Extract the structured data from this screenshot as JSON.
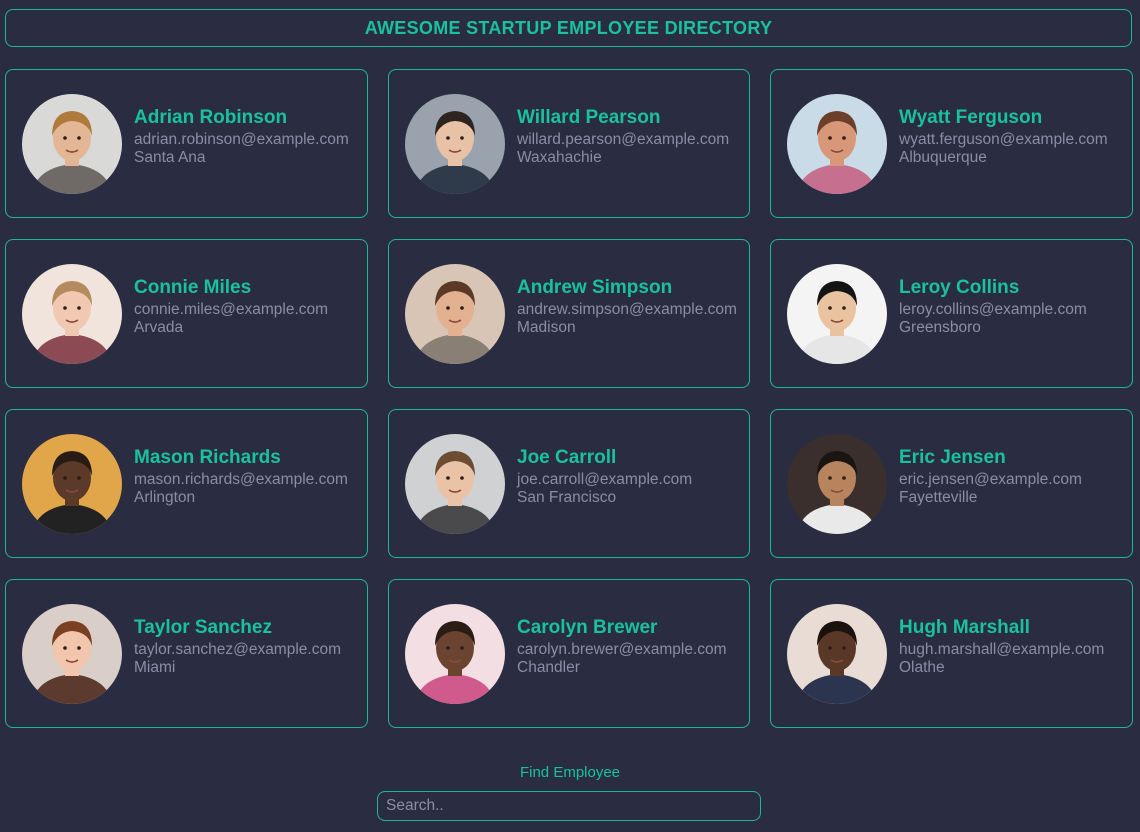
{
  "header": {
    "title": "AWESOME STARTUP EMPLOYEE DIRECTORY"
  },
  "colors": {
    "accent": "#19c29c",
    "background": "#2a2d42",
    "muted_text": "#8a8da6"
  },
  "employees": [
    {
      "name": "Adrian Robinson",
      "email": "adrian.robinson@example.com",
      "city": "Santa Ana",
      "photo": {
        "bg": "#d9d9d7",
        "skin": "#e3b796",
        "hair": "#b07a3c",
        "shirt": "#6f6a66"
      }
    },
    {
      "name": "Willard Pearson",
      "email": "willard.pearson@example.com",
      "city": "Waxahachie",
      "photo": {
        "bg": "#9aa3ad",
        "skin": "#e8c2a7",
        "hair": "#2d2420",
        "shirt": "#2f3b4a"
      }
    },
    {
      "name": "Wyatt Ferguson",
      "email": "wyatt.ferguson@example.com",
      "city": "Albuquerque",
      "photo": {
        "bg": "#c9dbe6",
        "skin": "#d9977a",
        "hair": "#6b3f2a",
        "shirt": "#c76f8e"
      }
    },
    {
      "name": "Connie Miles",
      "email": "connie.miles@example.com",
      "city": "Arvada",
      "photo": {
        "bg": "#f0e4dc",
        "skin": "#f1c9b3",
        "hair": "#b58a5e",
        "shirt": "#8c4a55"
      }
    },
    {
      "name": "Andrew Simpson",
      "email": "andrew.simpson@example.com",
      "city": "Madison",
      "photo": {
        "bg": "#d8c5b5",
        "skin": "#e3b190",
        "hair": "#5a3a26",
        "shirt": "#8a7f75"
      }
    },
    {
      "name": "Leroy Collins",
      "email": "leroy.collins@example.com",
      "city": "Greensboro",
      "photo": {
        "bg": "#f4f4f4",
        "skin": "#e9c3a0",
        "hair": "#141414",
        "shirt": "#e6e6e6"
      }
    },
    {
      "name": "Mason Richards",
      "email": "mason.richards@example.com",
      "city": "Arlington",
      "photo": {
        "bg": "#e2a64a",
        "skin": "#5b3a2a",
        "hair": "#2a1c15",
        "shirt": "#222222"
      }
    },
    {
      "name": "Joe Carroll",
      "email": "joe.carroll@example.com",
      "city": "San Francisco",
      "photo": {
        "bg": "#cfd1d3",
        "skin": "#eac2a6",
        "hair": "#6d4c34",
        "shirt": "#4a4a4d"
      }
    },
    {
      "name": "Eric Jensen",
      "email": "eric.jensen@example.com",
      "city": "Fayetteville",
      "photo": {
        "bg": "#3a2f2c",
        "skin": "#b8845e",
        "hair": "#1a1512",
        "shirt": "#e9e9e9"
      }
    },
    {
      "name": "Taylor Sanchez",
      "email": "taylor.sanchez@example.com",
      "city": "Miami",
      "photo": {
        "bg": "#d9cfc8",
        "skin": "#f2c6ad",
        "hair": "#7b3f22",
        "shirt": "#5d3a2e"
      }
    },
    {
      "name": "Carolyn Brewer",
      "email": "carolyn.brewer@example.com",
      "city": "Chandler",
      "photo": {
        "bg": "#f3dfe3",
        "skin": "#6b4331",
        "hair": "#2b1d16",
        "shirt": "#d15a8c"
      }
    },
    {
      "name": "Hugh Marshall",
      "email": "hugh.marshall@example.com",
      "city": "Olathe",
      "photo": {
        "bg": "#e8dcd4",
        "skin": "#5a3828",
        "hair": "#1c120d",
        "shirt": "#2c3550"
      }
    }
  ],
  "search": {
    "label": "Find Employee",
    "placeholder": "Search..",
    "value": ""
  }
}
